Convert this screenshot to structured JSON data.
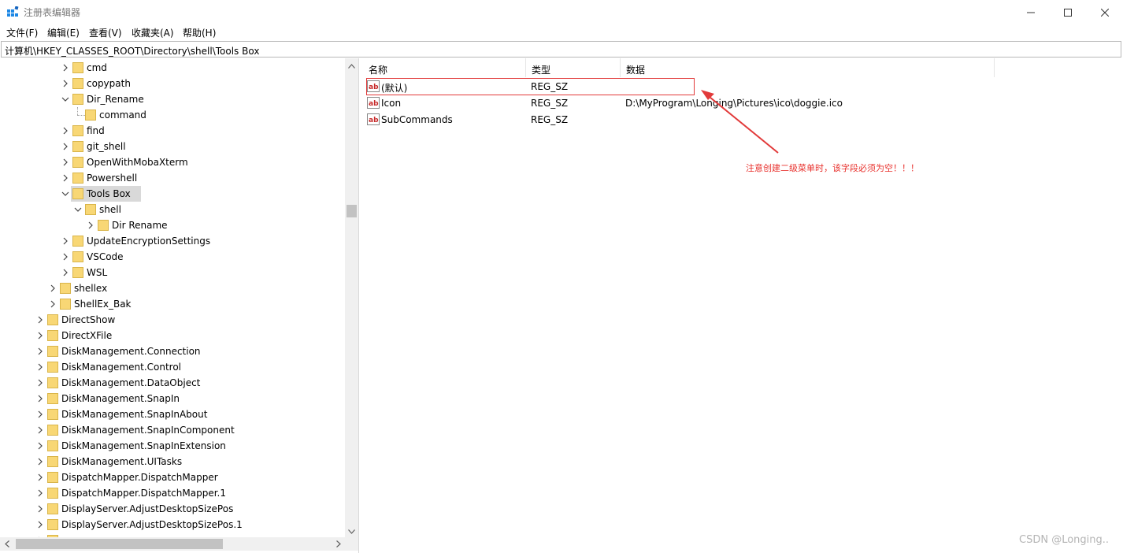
{
  "window": {
    "title": "注册表编辑器",
    "icon": "regedit-icon",
    "controls": [
      "minimize-icon",
      "maximize-icon",
      "close-icon"
    ]
  },
  "menu": {
    "items": [
      {
        "label": "文件(F)"
      },
      {
        "label": "编辑(E)"
      },
      {
        "label": "查看(V)"
      },
      {
        "label": "收藏夹(A)"
      },
      {
        "label": "帮助(H)"
      }
    ]
  },
  "address": {
    "path": "计算机\\HKEY_CLASSES_ROOT\\Directory\\shell\\Tools Box"
  },
  "tree": {
    "items": [
      {
        "label": "cmd",
        "expanded": false,
        "has_children": true,
        "depth": 4
      },
      {
        "label": "copypath",
        "expanded": false,
        "has_children": true,
        "depth": 4
      },
      {
        "label": "Dir_Rename",
        "expanded": true,
        "has_children": true,
        "depth": 4
      },
      {
        "label": "command",
        "expanded": false,
        "has_children": false,
        "depth": 5
      },
      {
        "label": "find",
        "expanded": false,
        "has_children": true,
        "depth": 4
      },
      {
        "label": "git_shell",
        "expanded": false,
        "has_children": true,
        "depth": 4
      },
      {
        "label": "OpenWithMobaXterm",
        "expanded": false,
        "has_children": true,
        "depth": 4
      },
      {
        "label": "Powershell",
        "expanded": false,
        "has_children": true,
        "depth": 4
      },
      {
        "label": "Tools Box",
        "expanded": true,
        "has_children": true,
        "depth": 4,
        "selected": true
      },
      {
        "label": "shell",
        "expanded": true,
        "has_children": true,
        "depth": 5
      },
      {
        "label": "Dir Rename",
        "expanded": false,
        "has_children": true,
        "depth": 6
      },
      {
        "label": "UpdateEncryptionSettings",
        "expanded": false,
        "has_children": true,
        "depth": 4
      },
      {
        "label": "VSCode",
        "expanded": false,
        "has_children": true,
        "depth": 4
      },
      {
        "label": "WSL",
        "expanded": false,
        "has_children": true,
        "depth": 4
      },
      {
        "label": "shellex",
        "expanded": false,
        "has_children": true,
        "depth": 3
      },
      {
        "label": "ShellEx_Bak",
        "expanded": false,
        "has_children": true,
        "depth": 3
      },
      {
        "label": "DirectShow",
        "expanded": false,
        "has_children": true,
        "depth": 2
      },
      {
        "label": "DirectXFile",
        "expanded": false,
        "has_children": true,
        "depth": 2
      },
      {
        "label": "DiskManagement.Connection",
        "expanded": false,
        "has_children": true,
        "depth": 2
      },
      {
        "label": "DiskManagement.Control",
        "expanded": false,
        "has_children": true,
        "depth": 2
      },
      {
        "label": "DiskManagement.DataObject",
        "expanded": false,
        "has_children": true,
        "depth": 2
      },
      {
        "label": "DiskManagement.SnapIn",
        "expanded": false,
        "has_children": true,
        "depth": 2
      },
      {
        "label": "DiskManagement.SnapInAbout",
        "expanded": false,
        "has_children": true,
        "depth": 2
      },
      {
        "label": "DiskManagement.SnapInComponent",
        "expanded": false,
        "has_children": true,
        "depth": 2
      },
      {
        "label": "DiskManagement.SnapInExtension",
        "expanded": false,
        "has_children": true,
        "depth": 2
      },
      {
        "label": "DiskManagement.UITasks",
        "expanded": false,
        "has_children": true,
        "depth": 2
      },
      {
        "label": "DispatchMapper.DispatchMapper",
        "expanded": false,
        "has_children": true,
        "depth": 2
      },
      {
        "label": "DispatchMapper.DispatchMapper.1",
        "expanded": false,
        "has_children": true,
        "depth": 2
      },
      {
        "label": "DisplayServer.AdjustDesktopSizePos",
        "expanded": false,
        "has_children": true,
        "depth": 2
      },
      {
        "label": "DisplayServer.AdjustDesktopSizePos.1",
        "expanded": false,
        "has_children": true,
        "depth": 2
      },
      {
        "label": "",
        "expanded": false,
        "has_children": true,
        "depth": 2
      }
    ]
  },
  "list": {
    "columns": [
      {
        "label": "名称"
      },
      {
        "label": "类型"
      },
      {
        "label": "数据"
      }
    ],
    "rows": [
      {
        "name": "(默认)",
        "type": "REG_SZ",
        "data": ""
      },
      {
        "name": "Icon",
        "type": "REG_SZ",
        "data": "D:\\MyProgram\\Longing\\Pictures\\ico\\doggie.ico"
      },
      {
        "name": "SubCommands",
        "type": "REG_SZ",
        "data": ""
      }
    ]
  },
  "annotation": {
    "text": "注意创建二级菜单时，该字段必须为空！！！",
    "color": "#e8322e"
  },
  "watermark": "CSDN @Longing..",
  "colors": {
    "selection": "#d9d9d9",
    "folder": "#f8d775",
    "highlight_box": "#e23a3a"
  }
}
